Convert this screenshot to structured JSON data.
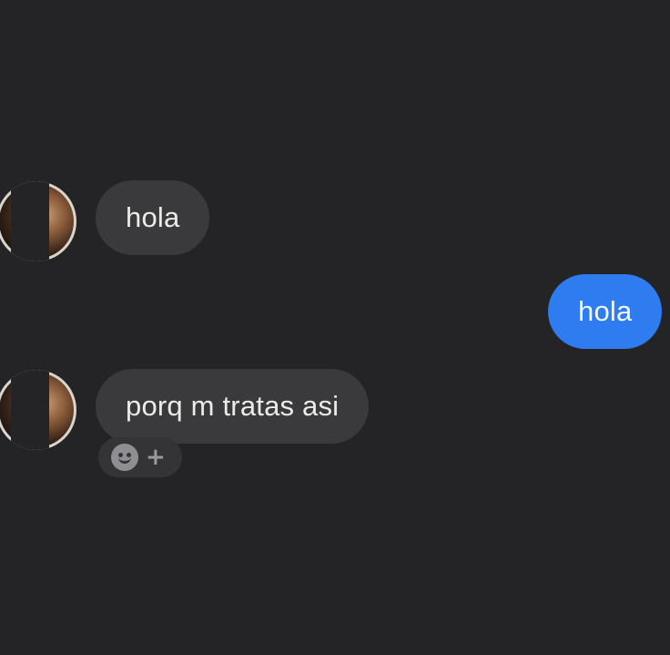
{
  "conversation": {
    "messages": [
      {
        "direction": "incoming",
        "text": "hola"
      },
      {
        "direction": "outgoing",
        "text": "hola"
      },
      {
        "direction": "incoming",
        "text": "porq m tratas asi"
      }
    ]
  },
  "reaction_bar": {
    "icon": "smiley-icon",
    "add_symbol": "+"
  },
  "colors": {
    "background": "#242426",
    "incoming_bubble": "#3a3a3c",
    "outgoing_bubble": "#2f7bf0"
  }
}
